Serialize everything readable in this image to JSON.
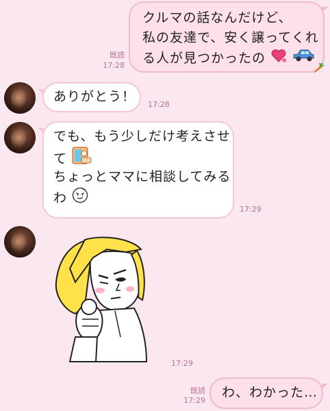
{
  "messages": [
    {
      "id": "m1",
      "side": "sent",
      "lines": [
        "クルマの話なんだけど、",
        "私の友達で、安く譲ってくれ",
        "る人が見つかったの"
      ],
      "read": "既読",
      "time": "17:28",
      "emoji": [
        "heart-icon",
        "blue-car-icon"
      ]
    },
    {
      "id": "m2",
      "side": "received",
      "lines": [
        "ありがとう！"
      ],
      "time": "17:28"
    },
    {
      "id": "m3",
      "side": "received",
      "lines": [
        "でも、もう少しだけ考えさせ",
        "て",
        "ちょっとママに相談してみる",
        "わ"
      ],
      "time": "17:29",
      "emoji": [
        "thinking-sticker-icon",
        "smirk-face-icon"
      ]
    },
    {
      "id": "m4",
      "side": "received",
      "type": "sticker",
      "sticker": "blonde-character-pointing-sticker",
      "time": "17:29"
    },
    {
      "id": "m5",
      "side": "sent",
      "lines": [
        "わ、わかった…"
      ],
      "read": "既読",
      "time": "17:29"
    }
  ],
  "colors": {
    "background": "#fbe7ef",
    "sent_bubble": "#fde0ea",
    "received_bubble": "#ffffff",
    "bubble_border": "#f4c7d6",
    "meta_text": "#b9708b"
  }
}
